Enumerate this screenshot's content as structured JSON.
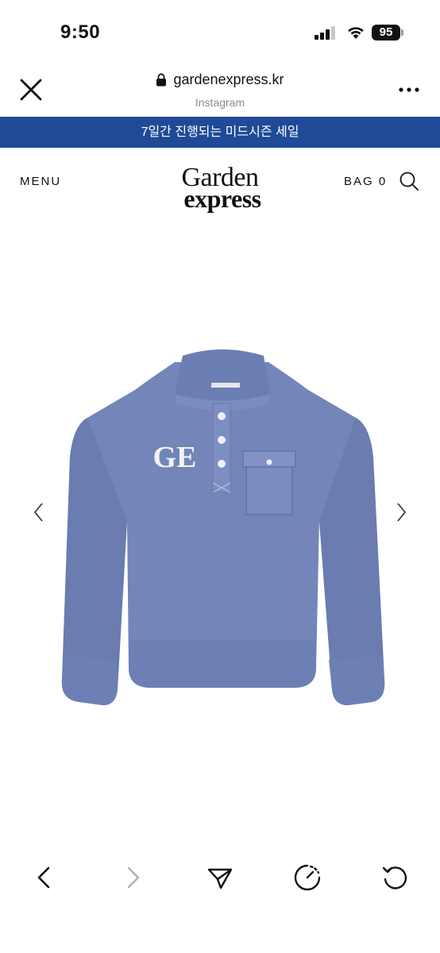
{
  "status_bar": {
    "time": "9:50",
    "battery_level": "95",
    "icons": [
      "signal-icon",
      "wifi-icon",
      "battery-icon"
    ]
  },
  "browser": {
    "url": "gardenexpress.kr",
    "source": "Instagram",
    "icons": [
      "close-icon",
      "lock-icon",
      "more-icon"
    ]
  },
  "promo_banner": {
    "text": "7일간 진행되는 미드시즌 세일",
    "color": "#1f4a97"
  },
  "site_header": {
    "menu_label": "MENU",
    "logo_line1": "Garden",
    "logo_line2": "express",
    "bag_label": "BAG 0",
    "icons": [
      "search-icon"
    ]
  },
  "product": {
    "image": "blue-half-button-sweatshirt",
    "patch_text": "GE",
    "garment_color": "#7385b9",
    "icons": [
      "chevron-left-icon",
      "chevron-right-icon"
    ]
  },
  "toolbar": {
    "icons": [
      "back-icon",
      "forward-icon",
      "share-icon",
      "timer-icon",
      "reload-icon"
    ]
  }
}
